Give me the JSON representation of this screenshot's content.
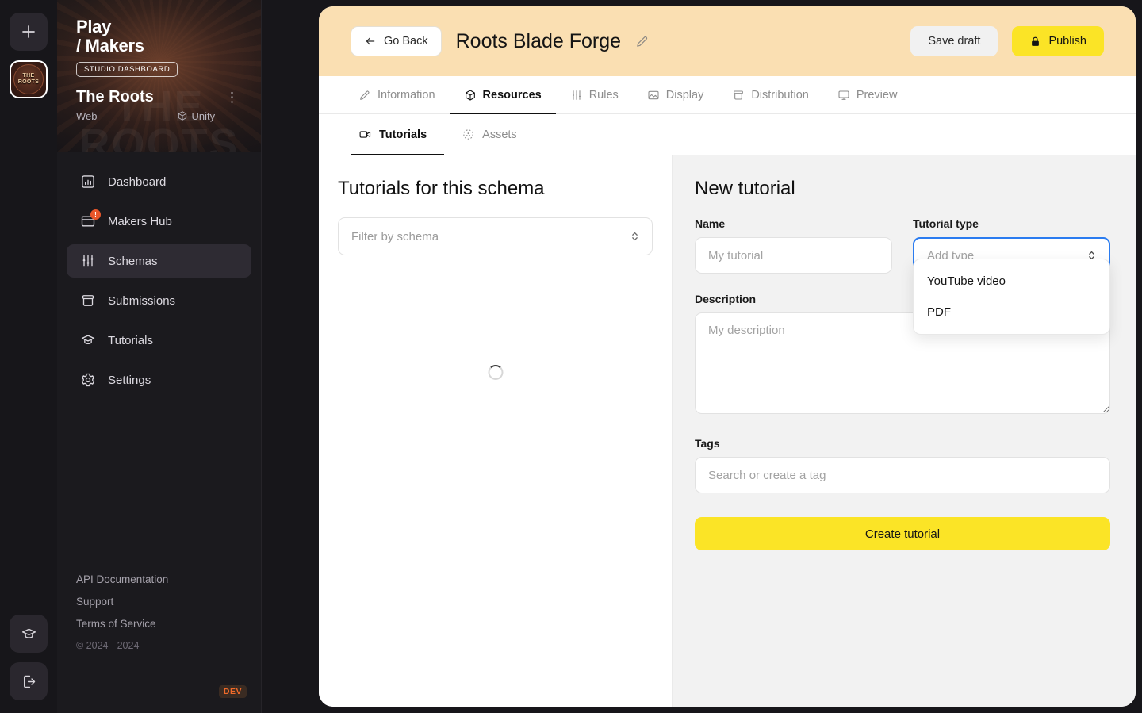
{
  "rail": {
    "add_label": "+",
    "workspace_avatar_label": "THE\nROOTS",
    "tutorials_icon": "graduation-cap-icon",
    "logout_icon": "logout-icon"
  },
  "sidebar": {
    "brand_line1": "Play",
    "brand_line2": "/ Makers",
    "studio_badge": "STUDIO DASHBOARD",
    "watermark": "THE\nROOTS",
    "workspace_name": "The Roots",
    "more_glyph": "⋮",
    "platforms": [
      {
        "label": "Web",
        "icon": "web-icon"
      },
      {
        "label": "Unity",
        "icon": "cube-icon"
      }
    ],
    "items": [
      {
        "label": "Dashboard",
        "icon": "chart-bar-icon",
        "active": false,
        "badge": ""
      },
      {
        "label": "Makers Hub",
        "icon": "window-icon",
        "active": false,
        "badge": "!"
      },
      {
        "label": "Schemas",
        "icon": "sliders-icon",
        "active": true,
        "badge": ""
      },
      {
        "label": "Submissions",
        "icon": "archive-box-icon",
        "active": false,
        "badge": ""
      },
      {
        "label": "Tutorials",
        "icon": "graduation-cap-icon",
        "active": false,
        "badge": ""
      },
      {
        "label": "Settings",
        "icon": "gear-icon",
        "active": false,
        "badge": ""
      }
    ],
    "footer_links": [
      "API Documentation",
      "Support",
      "Terms of Service"
    ],
    "copyright": "© 2024 - 2024",
    "dev_tag": "DEV"
  },
  "topbar": {
    "go_back": "Go Back",
    "project_title": "Roots Blade Forge",
    "edit_icon": "pencil-icon",
    "save_draft": "Save draft",
    "publish": "Publish",
    "publish_icon": "lock-icon"
  },
  "tabs": [
    {
      "label": "Information",
      "icon": "pencil-square-icon",
      "active": false
    },
    {
      "label": "Resources",
      "icon": "cube-icon",
      "active": true
    },
    {
      "label": "Rules",
      "icon": "sliders-icon",
      "active": false
    },
    {
      "label": "Display",
      "icon": "image-icon",
      "active": false
    },
    {
      "label": "Distribution",
      "icon": "archive-icon",
      "active": false
    },
    {
      "label": "Preview",
      "icon": "monitor-icon",
      "active": false
    }
  ],
  "subtabs": [
    {
      "label": "Tutorials",
      "icon": "video-camera-icon",
      "active": true
    },
    {
      "label": "Assets",
      "icon": "scatter-dots-icon",
      "active": false
    }
  ],
  "left_pane": {
    "heading": "Tutorials for this schema",
    "filter_placeholder": "Filter by schema",
    "loading": true
  },
  "form": {
    "heading": "New tutorial",
    "name_label": "Name",
    "name_placeholder": "My tutorial",
    "name_value": "",
    "type_label": "Tutorial type",
    "type_placeholder": "Add type",
    "type_value": "",
    "type_options": [
      "YouTube video",
      "PDF"
    ],
    "type_dropdown_open": true,
    "description_label": "Description",
    "description_placeholder": "My description",
    "description_value": "",
    "tags_label": "Tags",
    "tags_placeholder": "Search or create a tag",
    "tags_value": "",
    "submit_label": "Create tutorial"
  },
  "colors": {
    "header_peach": "#FADFB2",
    "accent_yellow": "#FBE426",
    "focus_blue": "#2B7CF0",
    "badge_orange": "#E8562A",
    "dev_orange": "#F06A2A",
    "sidebar_dark": "#1B1A1E",
    "rail_dark": "#17161A"
  }
}
